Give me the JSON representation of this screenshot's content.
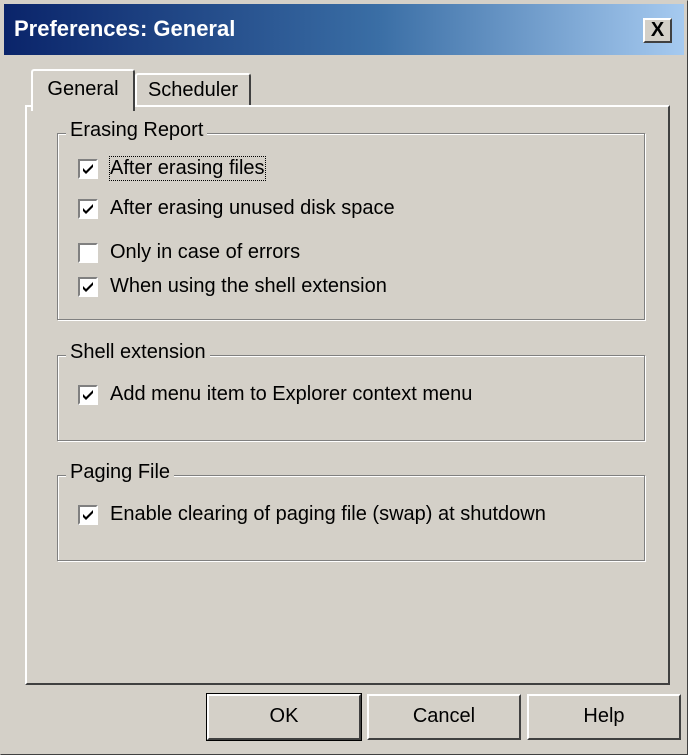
{
  "window": {
    "title": "Preferences: General",
    "close_label": "X"
  },
  "tabs": [
    {
      "label": "General",
      "active": true
    },
    {
      "label": "Scheduler",
      "active": false
    }
  ],
  "groups": [
    {
      "label": "Erasing Report",
      "options": [
        {
          "label": "After erasing files",
          "checked": true,
          "focused": true
        },
        {
          "label": "After erasing unused disk space",
          "checked": true
        },
        {
          "label": "Only in case of errors",
          "checked": false
        },
        {
          "label": "When using the shell extension",
          "checked": true
        }
      ]
    },
    {
      "label": "Shell extension",
      "options": [
        {
          "label": "Add menu item to Explorer context menu",
          "checked": true
        }
      ]
    },
    {
      "label": "Paging File",
      "options": [
        {
          "label": "Enable clearing of paging file (swap) at shutdown",
          "checked": true
        }
      ]
    }
  ],
  "buttons": {
    "ok": "OK",
    "cancel": "Cancel",
    "help": "Help"
  }
}
